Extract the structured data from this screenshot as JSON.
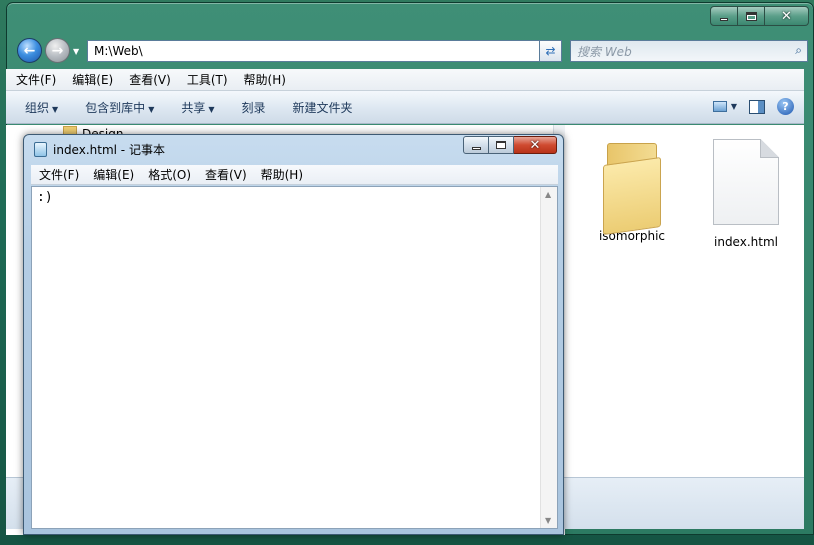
{
  "explorer": {
    "address": "M:\\Web\\",
    "search_placeholder": "搜索 Web",
    "menu": [
      "文件(F)",
      "编辑(E)",
      "查看(V)",
      "工具(T)",
      "帮助(H)"
    ],
    "toolbar": [
      "组织",
      "包含到库中",
      "共享",
      "刻录",
      "新建文件夹"
    ],
    "partial_item": "Design",
    "items": [
      {
        "name": "isomorphic",
        "icon": "folder-icon"
      },
      {
        "name": "index.html",
        "icon": "document-icon"
      }
    ]
  },
  "notepad": {
    "title": "index.html - 记事本",
    "menu": [
      "文件(F)",
      "编辑(E)",
      "格式(O)",
      "查看(V)",
      "帮助(H)"
    ],
    "content": ":)"
  }
}
